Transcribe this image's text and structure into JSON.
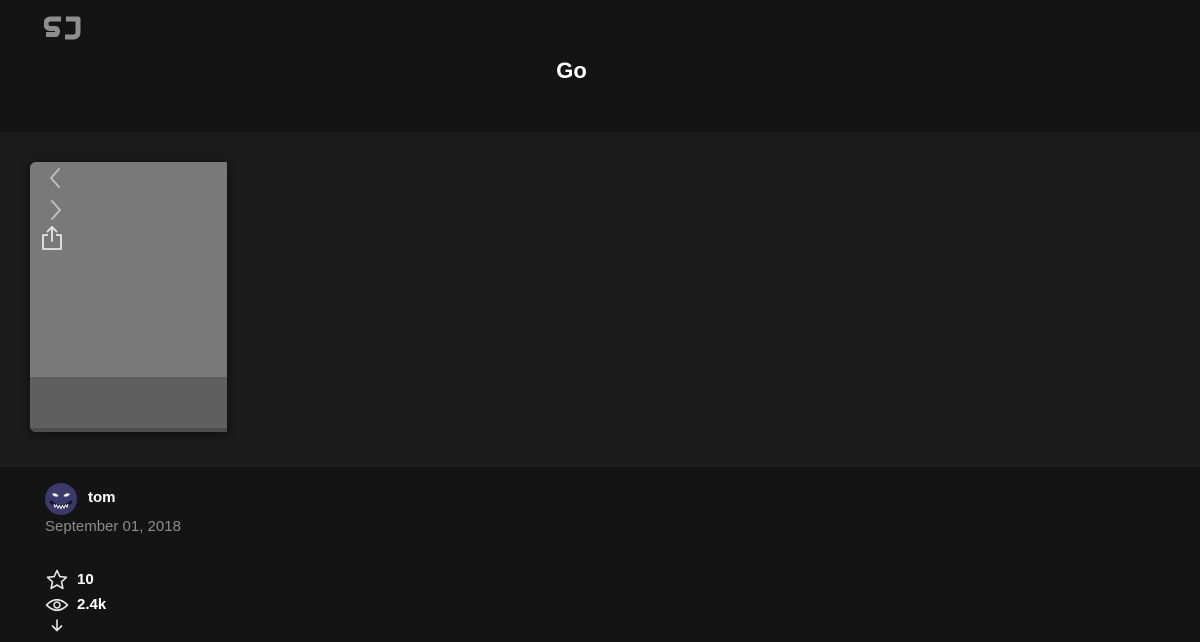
{
  "header": {
    "logo_icon": "sj-logo-icon",
    "title": "Go"
  },
  "slideshow": {
    "controls": [
      {
        "name": "previous-slide",
        "icon": "chevron-left-icon"
      },
      {
        "name": "next-slide",
        "icon": "chevron-right-icon"
      },
      {
        "name": "share",
        "icon": "share-icon"
      }
    ],
    "colors": {
      "slide_body": "#797979",
      "slide_footer": "#5f5f5f",
      "stage_background": "#1b1b1b"
    }
  },
  "author": {
    "name": "tom",
    "avatar_icon": "monster-face-avatar",
    "date": "September 01, 2018"
  },
  "stats": {
    "likes": "10",
    "views": "2.4k",
    "downloads": ""
  },
  "colors": {
    "background": "#141414",
    "text": "#ffffff",
    "muted_text": "#8c8c8c",
    "avatar": "#3b3a6b"
  }
}
